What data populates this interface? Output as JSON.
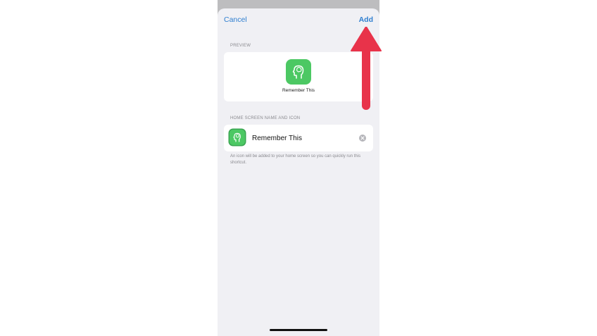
{
  "nav": {
    "cancel_label": "Cancel",
    "add_label": "Add"
  },
  "preview": {
    "header": "PREVIEW",
    "app_name": "Remember This",
    "icon": "head-brain-icon"
  },
  "home_screen": {
    "header": "HOME SCREEN NAME AND ICON",
    "name_value": "Remember This",
    "icon": "head-brain-icon",
    "clear_icon": "clear-icon",
    "footnote": "An icon will be added to your home screen so you can quickly run this shortcut."
  },
  "annotation": {
    "arrow_color": "#e8334a"
  },
  "colors": {
    "accent": "#2f7fd0",
    "icon_green": "#4cc863",
    "sheet_background": "#f0f0f4"
  }
}
